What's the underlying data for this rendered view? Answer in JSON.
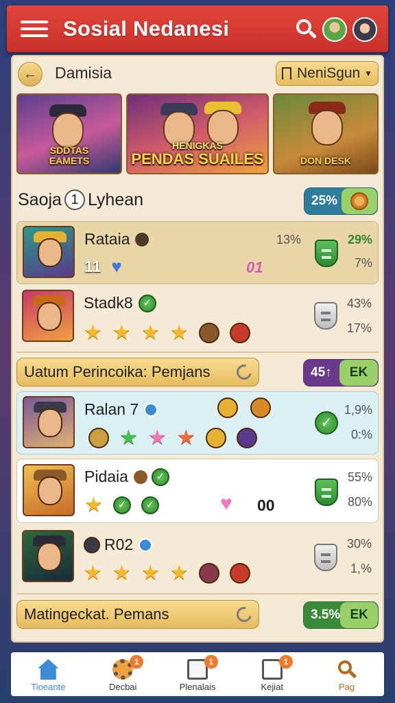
{
  "header": {
    "title": "Sosial Nedanesi",
    "search_icon": "search-icon",
    "avatars": [
      "user-avatar-green",
      "user-avatar-dark"
    ]
  },
  "nav": {
    "back_icon": "arrow-left-icon",
    "section_title": "Damisia",
    "dropdown": {
      "flag_icon": "flag-icon",
      "label": "NeniSgun",
      "caret_icon": "caret-down-icon"
    }
  },
  "banners": [
    {
      "text_line1": "SDDTAS",
      "text_line2": "EAMETS"
    },
    {
      "text_small": "HENIGKAS",
      "text_main": "PENDAS SUAILES"
    },
    {
      "text": "DON DESK"
    }
  ],
  "group": {
    "label_left": "Saoja",
    "number": "1",
    "label_right": "Lyhean",
    "pill_value": "25%"
  },
  "rows": [
    {
      "name": "Rataia",
      "stat1": "13%",
      "stat2": "29%",
      "stat3": "7%",
      "count": "11",
      "extra": "01"
    },
    {
      "name": "Stadk8",
      "stat1": "43%",
      "stat2": "17%"
    },
    {
      "name": "Ralan 7",
      "stat1": "1,9%",
      "stat2": "0:%"
    },
    {
      "name": "Pidaia",
      "stat1": "55%",
      "stat2": "80%",
      "extra": "00"
    },
    {
      "name": "R02",
      "stat1": "30%",
      "stat2": "1,%"
    }
  ],
  "bars": [
    {
      "label": "Uatum Perincoika: Pemjans",
      "pill_value": "45↑",
      "pill_end": "EK"
    },
    {
      "label": "Matingeckat. Pemans",
      "pill_value": "3.5%",
      "pill_end": "EK"
    }
  ],
  "bottom_nav": [
    {
      "label": "Tioeante",
      "icon": "home-icon"
    },
    {
      "label": "Decbai",
      "icon": "gear-icon",
      "badge": "1"
    },
    {
      "label": "Plenalais",
      "icon": "document-icon",
      "badge": "1"
    },
    {
      "label": "Kejiat",
      "icon": "edit-icon",
      "badge": "1"
    },
    {
      "label": "Pag",
      "icon": "search-icon"
    }
  ],
  "colors": {
    "header_red": "#d63a32",
    "panel_bg": "#f4ead6",
    "accent_gold": "#e6bb5e",
    "green": "#2c8a2c"
  }
}
